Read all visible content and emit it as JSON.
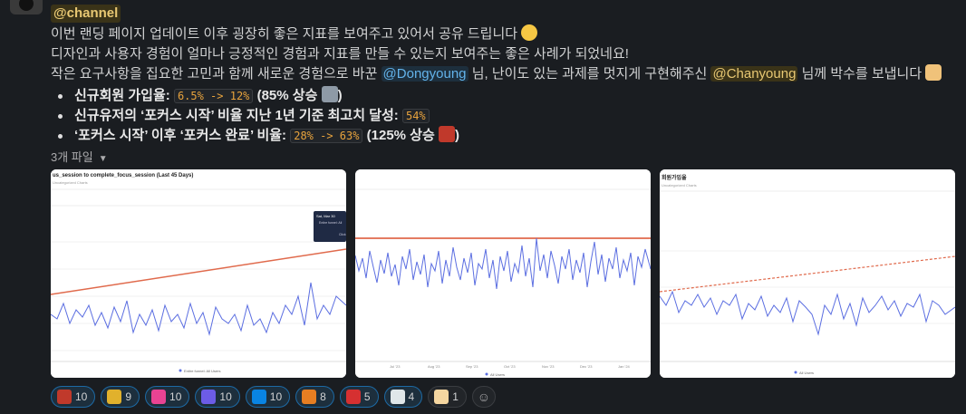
{
  "message": {
    "channel_mention": "@channel",
    "line1": "이번 랜딩 페이지 업데이트 이후 굉장히 좋은 지표를 보여주고 있어서 공유 드립니다",
    "line2": "디자인과 사용자 경험이 얼마나 긍정적인 경험과 지표를 만들 수 있는지 보여주는 좋은 사례가 되었네요!",
    "line3_a": "작은 요구사항을 집요한 고민과 함께 새로운 경험으로 바꾼",
    "mention_1": "@Dongyoung",
    "line3_b": "님, 난이도 있는 과제를 멋지게 구현해주신",
    "mention_2": "@Chanyoung",
    "line3_c": "님께 박수를 보냅니다",
    "bullets": [
      {
        "label": "신규회원 가입율:",
        "code": "6.5% -> 12%",
        "suffix": "(85% 상승",
        "close": ")"
      },
      {
        "label": "신규유저의 ‘포커스 시작’ 비율 지난 1년 기준 최고치 달성:",
        "code": "54%",
        "suffix": "",
        "close": ""
      },
      {
        "label": "‘포커스 시작’ 이후 ‘포커스 완료’ 비율:",
        "code": "28% -> 63%",
        "suffix": "(125% 상승",
        "close": ")"
      }
    ]
  },
  "files": {
    "label": "3개 파일",
    "thumbs": [
      {
        "title": "us_session to complete_focus_session (Last 45 Days)",
        "subtitle": "Uncategorized Charts",
        "legend": "Entire funnel: All Users",
        "tooltip_date": "Sat, Mar 30",
        "tooltip_text": "Entire funnel: All",
        "tooltip_more": "Click"
      },
      {
        "title": "",
        "legend": "All Users",
        "xticks": [
          "Jul '23",
          "Aug '23",
          "Sep '23",
          "Oct '23",
          "Nov '23",
          "Dec '23",
          "Jan '24"
        ]
      },
      {
        "title": "회원가입율",
        "subtitle": "Uncategorized Charts",
        "legend": "All Users"
      }
    ]
  },
  "reactions": [
    {
      "name": "dragon",
      "count": "10",
      "color": "#c0392b",
      "active": true
    },
    {
      "name": "crown-cat",
      "count": "9",
      "color": "#e1b12c",
      "active": true
    },
    {
      "name": "heart",
      "count": "10",
      "color": "#e84393",
      "active": true
    },
    {
      "name": "custom-text-1",
      "count": "10",
      "color": "#6c5ce7",
      "active": true
    },
    {
      "name": "custom-text-2",
      "count": "10",
      "color": "#0984e3",
      "active": true
    },
    {
      "name": "fire-100",
      "count": "8",
      "color": "#e67e22",
      "active": true
    },
    {
      "name": "tomato",
      "count": "5",
      "color": "#d63031",
      "active": true
    },
    {
      "name": "soccer",
      "count": "4",
      "color": "#dfe6e9",
      "active": true
    },
    {
      "name": "raised-hands",
      "count": "1",
      "color": "#f5d6a0",
      "active": false
    }
  ]
}
